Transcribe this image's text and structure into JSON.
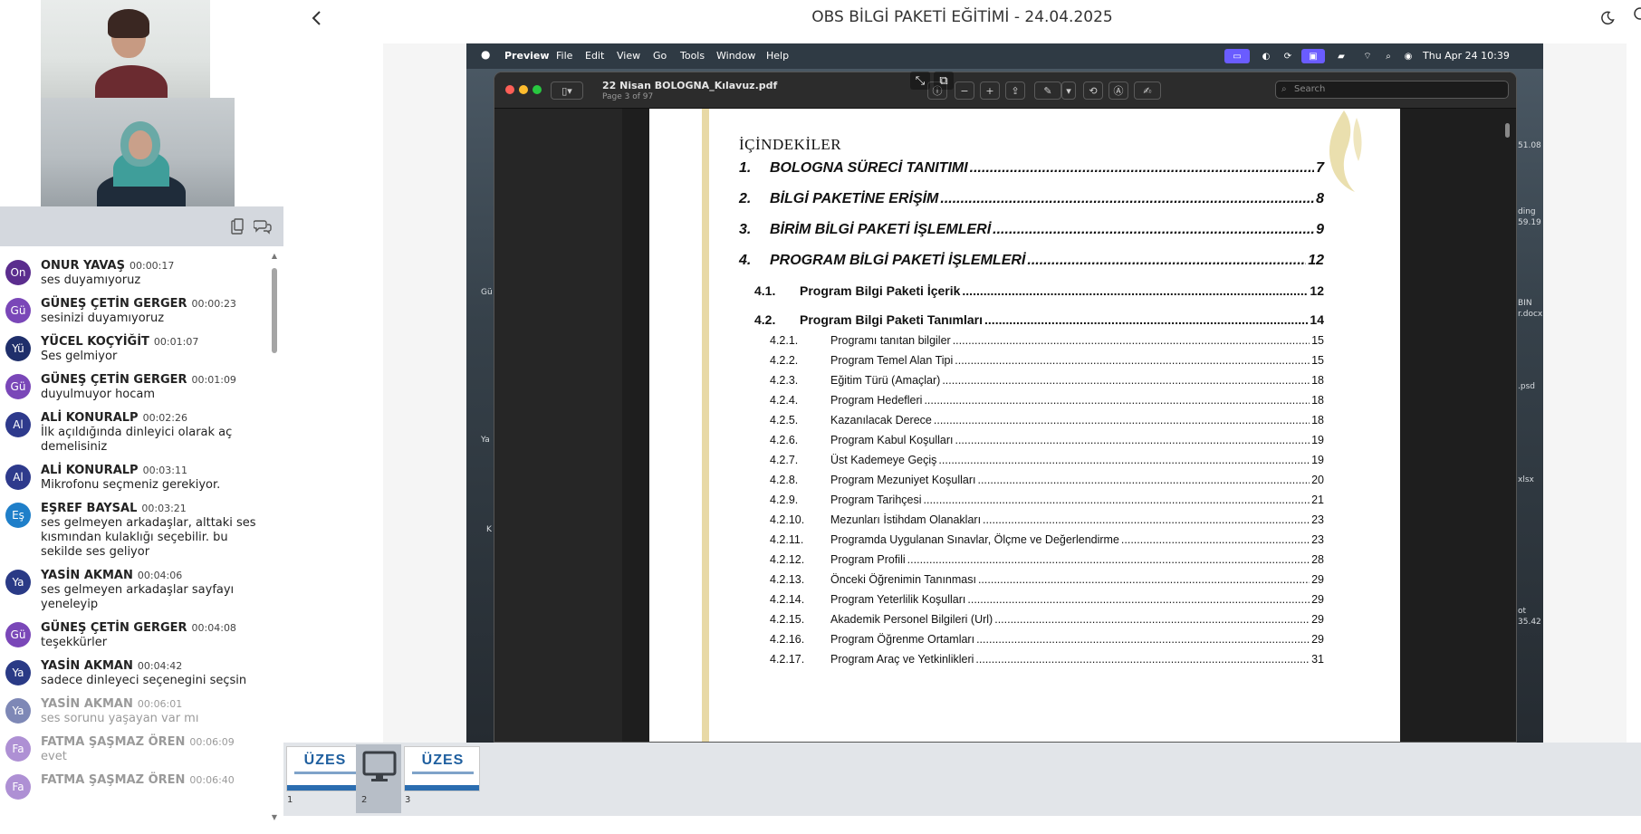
{
  "header": {
    "title": "OBS BİLGİ PAKETİ EĞİTİMİ - 24.04.2025"
  },
  "chat": {
    "messages": [
      {
        "initials": "On",
        "name": "ONUR YAVAŞ",
        "time": "00:00:17",
        "text": "ses duyamıyoruz",
        "color": "#5b2d8e"
      },
      {
        "initials": "Gü",
        "name": "GÜNEŞ ÇETİN GERGER",
        "time": "00:00:23",
        "text": "sesinizi duyamıyoruz",
        "color": "#7a47b8"
      },
      {
        "initials": "Yü",
        "name": "YÜCEL KOÇYİĞİT",
        "time": "00:01:07",
        "text": "Ses gelmiyor",
        "color": "#1f2f6b"
      },
      {
        "initials": "Gü",
        "name": "GÜNEŞ ÇETİN GERGER",
        "time": "00:01:09",
        "text": "duyulmuyor hocam",
        "color": "#7a47b8"
      },
      {
        "initials": "Al",
        "name": "ALİ KONURALP",
        "time": "00:02:26",
        "text": "İlk açıldığında dinleyici olarak aç demelisiniz",
        "color": "#2e3a8c"
      },
      {
        "initials": "Al",
        "name": "ALİ KONURALP",
        "time": "00:03:11",
        "text": "Mikrofonu seçmeniz gerekiyor.",
        "color": "#2e3a8c"
      },
      {
        "initials": "Eş",
        "name": "EŞREF BAYSAL",
        "time": "00:03:21",
        "text": "ses gelmeyen arkadaşlar, alttaki ses kısmından kulaklığı seçebilir. bu sekilde ses geliyor",
        "color": "#1f7fc9"
      },
      {
        "initials": "Ya",
        "name": "YASİN AKMAN",
        "time": "00:04:06",
        "text": "ses gelmeyen arkadaşlar sayfayı yeneleyip",
        "color": "#2a3a86"
      },
      {
        "initials": "Gü",
        "name": "GÜNEŞ ÇETİN GERGER",
        "time": "00:04:08",
        "text": "teşekkürler",
        "color": "#7a47b8"
      },
      {
        "initials": "Ya",
        "name": "YASİN AKMAN",
        "time": "00:04:42",
        "text": "sadece dinleyeci seçenegini seçsin",
        "color": "#2a3a86"
      },
      {
        "initials": "Ya",
        "name": "YASİN AKMAN",
        "time": "00:06:01",
        "text": "ses sorunu yaşayan var mı",
        "color": "#2a3a86",
        "faded": true
      },
      {
        "initials": "Fa",
        "name": "FATMA ŞAŞMAZ ÖREN",
        "time": "00:06:09",
        "text": "evet",
        "color": "#7a47b8",
        "faded": true
      },
      {
        "initials": "Fa",
        "name": "FATMA ŞAŞMAZ ÖREN",
        "time": "00:06:40",
        "text": "",
        "color": "#7a47b8",
        "faded": true
      }
    ]
  },
  "menubar": {
    "app": "Preview",
    "items": [
      "File",
      "Edit",
      "View",
      "Go",
      "Tools",
      "Window",
      "Help"
    ],
    "clock": "Thu Apr 24  10:39"
  },
  "preview": {
    "doc_title": "22 Nisan BOLOGNA_Kılavuz.pdf",
    "page_info": "Page 3 of 97",
    "search_placeholder": "Search"
  },
  "desktop_labels": [
    "51.08",
    "ding",
    "59.19",
    "BIN",
    "r.docx",
    ".psd",
    "xlsx",
    "ot",
    "35.42",
    "Gü",
    "Ya",
    "K"
  ],
  "toc": {
    "heading": "İÇİNDEKİLER",
    "entries": [
      {
        "level": 1,
        "num": "1.",
        "title": "BOLOGNA SÜRECİ TANITIMI",
        "page": "7"
      },
      {
        "level": 1,
        "num": "2.",
        "title": "BİLGİ PAKETİNE ERİŞİM",
        "page": "8"
      },
      {
        "level": 1,
        "num": "3.",
        "title": "BİRİM BİLGİ PAKETİ İŞLEMLERİ",
        "page": "9"
      },
      {
        "level": 1,
        "num": "4.",
        "title": "PROGRAM BİLGİ PAKETİ İŞLEMLERİ",
        "page": "12"
      },
      {
        "level": 2,
        "num": "4.1.",
        "title": "Program Bilgi Paketi İçerik",
        "page": "12"
      },
      {
        "level": 2,
        "num": "4.2.",
        "title": "Program Bilgi Paketi Tanımları",
        "page": "14"
      },
      {
        "level": 3,
        "num": "4.2.1.",
        "title": "Programı tanıtan bilgiler",
        "page": "15"
      },
      {
        "level": 3,
        "num": "4.2.2.",
        "title": "Program Temel Alan Tipi",
        "page": "15"
      },
      {
        "level": 3,
        "num": "4.2.3.",
        "title": "Eğitim Türü (Amaçlar)",
        "page": "18"
      },
      {
        "level": 3,
        "num": "4.2.4.",
        "title": "Program Hedefleri",
        "page": "18"
      },
      {
        "level": 3,
        "num": "4.2.5.",
        "title": "Kazanılacak Derece",
        "page": "18"
      },
      {
        "level": 3,
        "num": "4.2.6.",
        "title": "Program Kabul Koşulları",
        "page": "19"
      },
      {
        "level": 3,
        "num": "4.2.7.",
        "title": "Üst Kademeye Geçiş",
        "page": "19"
      },
      {
        "level": 3,
        "num": "4.2.8.",
        "title": "Program Mezuniyet Koşulları",
        "page": "20"
      },
      {
        "level": 3,
        "num": "4.2.9.",
        "title": "Program Tarihçesi",
        "page": "21"
      },
      {
        "level": 3,
        "num": "4.2.10.",
        "title": "Mezunları İstihdam Olanakları",
        "page": "23"
      },
      {
        "level": 3,
        "num": "4.2.11.",
        "title": "Programda Uygulanan Sınavlar, Ölçme ve Değerlendirme",
        "page": "23"
      },
      {
        "level": 3,
        "num": "4.2.12.",
        "title": "Program Profili",
        "page": "28"
      },
      {
        "level": 3,
        "num": "4.2.13.",
        "title": "Önceki Öğrenimin Tanınması",
        "page": "29"
      },
      {
        "level": 3,
        "num": "4.2.14.",
        "title": "Program Yeterlilik Koşulları",
        "page": "29"
      },
      {
        "level": 3,
        "num": "4.2.15.",
        "title": "Akademik Personel Bilgileri (Url)",
        "page": "29"
      },
      {
        "level": 3,
        "num": "4.2.16.",
        "title": "Program Öğrenme Ortamları",
        "page": "29"
      },
      {
        "level": 3,
        "num": "4.2.17.",
        "title": "Program Araç ve Yetkinlikleri",
        "page": "31"
      }
    ]
  },
  "slides": [
    {
      "num": "1",
      "logo": "ÜZES"
    },
    {
      "num": "2",
      "logo": ""
    },
    {
      "num": "3",
      "logo": "ÜZES"
    }
  ],
  "colors": {
    "toolbar_bg": "#d4d8de",
    "strip_bg": "#e2e5e9",
    "pdf_accent": "#e8d9a6"
  }
}
